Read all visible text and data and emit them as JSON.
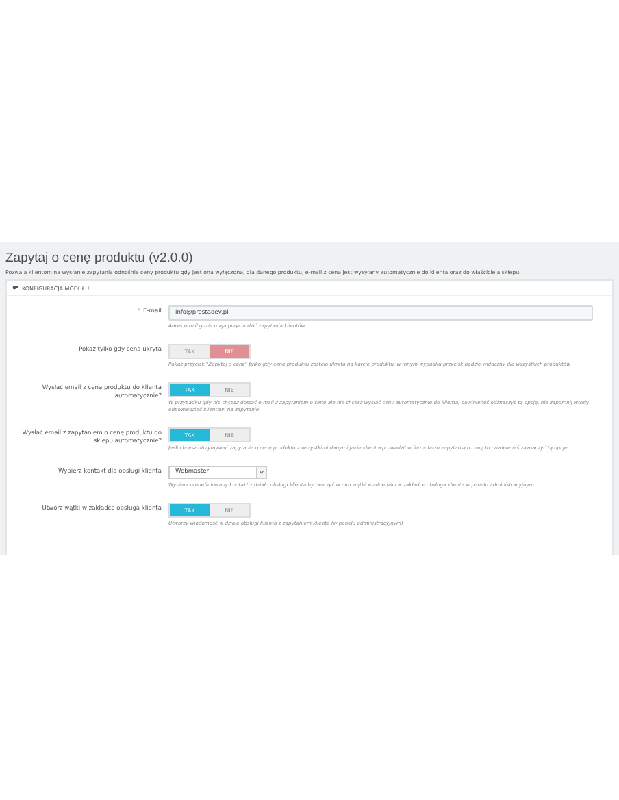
{
  "page": {
    "title": "Zapytaj o cenę produktu (v2.0.0)",
    "description": "Pozwala klientom na wysłanie zapytania odnośnie ceny produktu gdy jest ona wyłączona, dla danego produktu, e-mail z ceną jest wysyłany automatycznie do klienta oraz do właściciela sklepu."
  },
  "panel": {
    "heading": "KONFIGURACJA MODUŁU",
    "fields": [
      {
        "kind": "text",
        "label": "E-mail",
        "required_mark": "*",
        "value": "info@prestadev.pl",
        "help": "Adres email gdzie mają przychodzić zapytania klientów"
      },
      {
        "kind": "switch",
        "label": "Pokaż tylko gdy cena ukryta",
        "options": [
          {
            "label": "TAK",
            "selected": false
          },
          {
            "label": "NIE",
            "selected": true
          }
        ],
        "help": "Pokaż przycisk \"Zapytaj o cenę\" tylko gdy cena produktu zostało ukryta na karcie produktu, w innym wypadku przycisk będzie widoczny dla wszystkich produktów"
      },
      {
        "kind": "switch",
        "label": "Wysłać email z ceną produktu do klienta automatycznie?",
        "options": [
          {
            "label": "TAK",
            "selected": true
          },
          {
            "label": "NIE",
            "selected": false
          }
        ],
        "help": "W przypadku gdy nie chcesz dostać e-mail z zapytaniem o cenę ale nie chcesz wysłać ceny automatycznie do klienta, powinieneś odznaczyć tą opcję, nie zapomnij wtedy odpowiedzieć klientowi na zapytanie."
      },
      {
        "kind": "switch",
        "label": "Wysłać email z zapytaniem o cenę produktu do sklepu automatycznie?",
        "options": [
          {
            "label": "TAK",
            "selected": true
          },
          {
            "label": "NIE",
            "selected": false
          }
        ],
        "help": "Jeśli chcesz otrzymywać zapytania o cenę produktu z wszystkimi danymi jakie klient wprowadził w formularzu zapytania o cenę to powinieneś zaznaczyć tą opcję."
      },
      {
        "kind": "select",
        "label": "Wybierz kontakt dla obsługi klienta",
        "value": "Webmaster",
        "help": "Wybierz predefiniowany kontakt z działu obsługi klienta by tworzyć w nim wątki wiadomości w zakładce obsługa klienta w panelu administracyjnym"
      },
      {
        "kind": "switch",
        "label": "Utwórz wątki w zakładce obsługa klienta",
        "options": [
          {
            "label": "TAK",
            "selected": true
          },
          {
            "label": "NIE",
            "selected": false
          }
        ],
        "help": "Utworzy wiadomość w dziale obsługi klienta z zapytaniem klienta (w panelu administracyjnym)"
      }
    ]
  }
}
